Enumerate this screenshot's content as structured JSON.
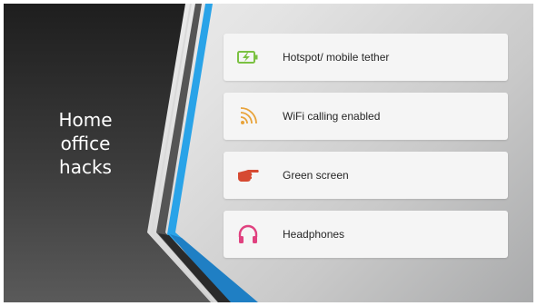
{
  "slide": {
    "title_lines": [
      "Home",
      "office",
      "hacks"
    ]
  },
  "cards": [
    {
      "label": "Hotspot/ mobile tether",
      "icon": "battery-charging-icon",
      "color": "#7bc142"
    },
    {
      "label": "WiFi calling enabled",
      "icon": "wifi-signal-icon",
      "color": "#e8a33a"
    },
    {
      "label": "Green screen",
      "icon": "pointing-hand-icon",
      "color": "#d64a32"
    },
    {
      "label": "Headphones",
      "icon": "headphones-icon",
      "color": "#e0417f"
    }
  ],
  "colors": {
    "dark_panel": "#3a3a3a",
    "accent_blue": "#29a3e8",
    "stripe_gray": "#6e6e6e"
  }
}
